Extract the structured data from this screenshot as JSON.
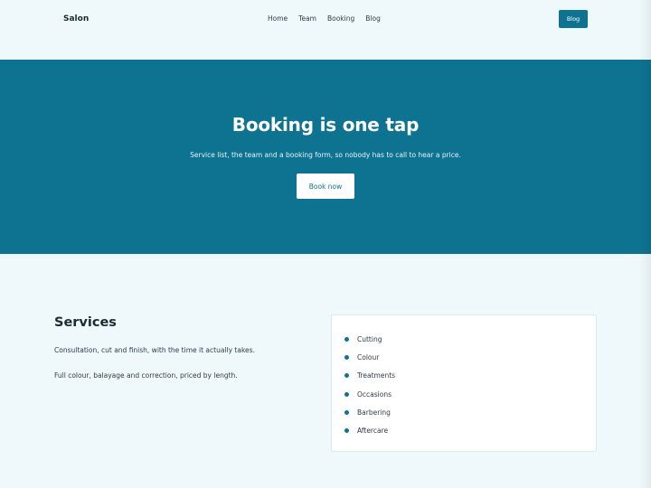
{
  "header": {
    "brand": "Salon",
    "nav": [
      "Home",
      "Team",
      "Booking",
      "Blog"
    ],
    "cta_label": "Blog"
  },
  "hero": {
    "title": "Booking is one tap",
    "subtitle": "Service list, the team and a booking form, so nobody has to call to hear a price.",
    "button_label": "Book now"
  },
  "services": {
    "title": "Services",
    "paragraphs": [
      "Consultation, cut and finish, with the time it actually takes.",
      "Full colour, balayage and correction, priced by length."
    ],
    "items": [
      "Cutting",
      "Colour",
      "Treatments",
      "Occasions",
      "Barbering",
      "Aftercare"
    ]
  },
  "colors": {
    "accent": "#0e7391",
    "background": "#eff9fc",
    "text": "#1b2a33"
  }
}
